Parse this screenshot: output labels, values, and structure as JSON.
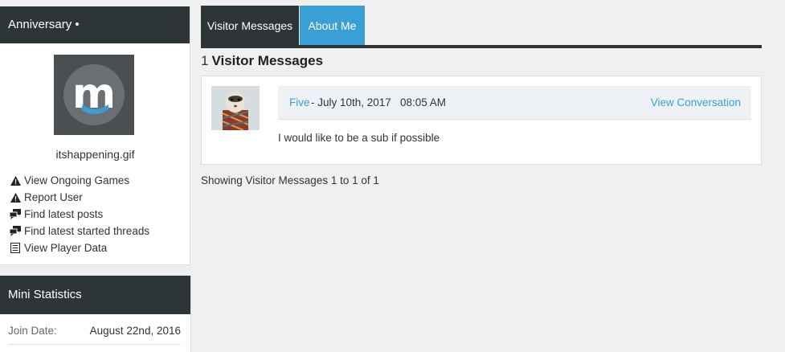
{
  "sidebar": {
    "profile": {
      "title": "Anniversary",
      "title_marker": "•",
      "avatar_letter": "m",
      "avatar_caption": "itshappening.gif",
      "links": [
        {
          "label": "View Ongoing Games",
          "icon": "warning-icon"
        },
        {
          "label": "Report User",
          "icon": "warning-icon"
        },
        {
          "label": "Find latest posts",
          "icon": "chat-bubbles-icon"
        },
        {
          "label": "Find latest started threads",
          "icon": "chat-bubbles-icon"
        },
        {
          "label": "View Player Data",
          "icon": "document-icon"
        }
      ]
    },
    "stats": {
      "title": "Mini Statistics",
      "join_label": "Join Date:",
      "join_value": "August 22nd, 2016"
    }
  },
  "main": {
    "tabs": [
      {
        "label": "Visitor Messages",
        "active": true
      },
      {
        "label": "About Me",
        "active": false
      }
    ],
    "section": {
      "count": "1",
      "title": "Visitor Messages"
    },
    "message": {
      "author": "Five",
      "date": "- July 10th, 2017",
      "time": "08:05 AM",
      "view_link": "View Conversation",
      "text": "I would like to be a sub if possible"
    },
    "showing": "Showing Visitor Messages 1 to 1 of 1"
  },
  "colors": {
    "dark_header": "#2e3539",
    "accent_blue": "#39a0d5",
    "page_bg": "#f0f0f0"
  }
}
